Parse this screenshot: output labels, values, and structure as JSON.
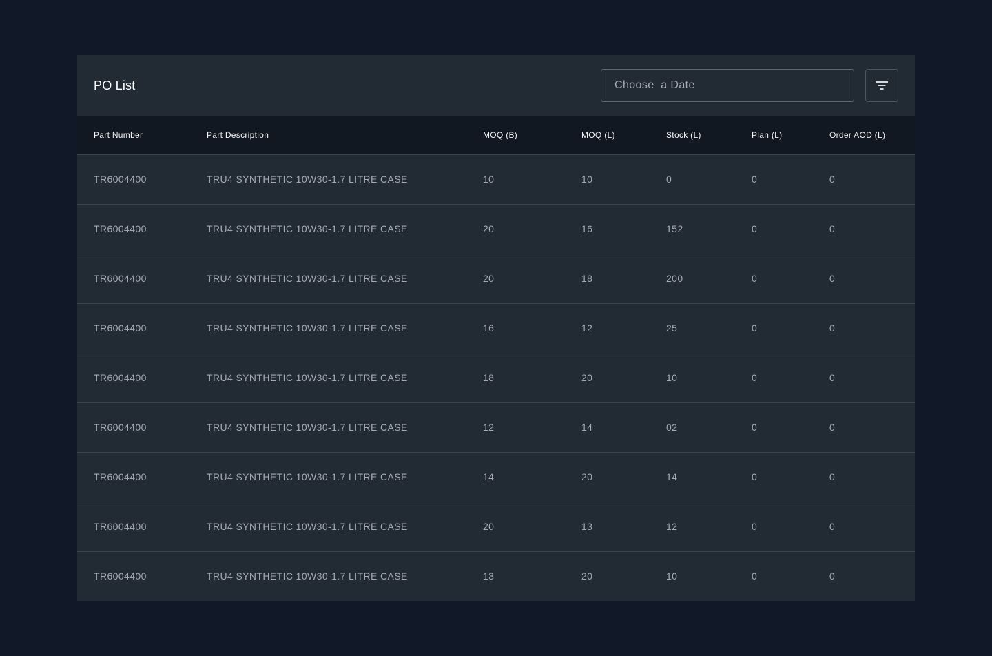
{
  "header": {
    "title": "PO List",
    "date_placeholder": "Choose  a Date",
    "filter_icon": "filter-icon"
  },
  "table": {
    "columns": [
      "Part Number",
      "Part Description",
      "MOQ (B)",
      "MOQ (L)",
      "Stock (L)",
      "Plan (L)",
      "Order AOD (L)"
    ],
    "rows": [
      [
        "TR6004400",
        "TRU4 SYNTHETIC 10W30-1.7 LITRE CASE",
        "10",
        "10",
        "0",
        "0",
        "0"
      ],
      [
        "TR6004400",
        "TRU4 SYNTHETIC 10W30-1.7 LITRE CASE",
        "20",
        "16",
        "152",
        "0",
        "0"
      ],
      [
        "TR6004400",
        "TRU4 SYNTHETIC 10W30-1.7 LITRE CASE",
        "20",
        "18",
        "200",
        "0",
        "0"
      ],
      [
        "TR6004400",
        "TRU4 SYNTHETIC 10W30-1.7 LITRE CASE",
        "16",
        "12",
        "25",
        "0",
        "0"
      ],
      [
        "TR6004400",
        "TRU4 SYNTHETIC 10W30-1.7 LITRE CASE",
        "18",
        "20",
        "10",
        "0",
        "0"
      ],
      [
        "TR6004400",
        "TRU4 SYNTHETIC 10W30-1.7 LITRE CASE",
        "12",
        "14",
        "02",
        "0",
        "0"
      ],
      [
        "TR6004400",
        "TRU4 SYNTHETIC 10W30-1.7 LITRE CASE",
        "14",
        "20",
        "14",
        "0",
        "0"
      ],
      [
        "TR6004400",
        "TRU4 SYNTHETIC 10W30-1.7 LITRE CASE",
        "20",
        "13",
        "12",
        "0",
        "0"
      ],
      [
        "TR6004400",
        "TRU4 SYNTHETIC 10W30-1.7 LITRE CASE",
        "13",
        "20",
        "10",
        "0",
        "0"
      ]
    ]
  },
  "colors": {
    "page_bg": "#111827",
    "card_bg": "#222A34",
    "header_row_bg": "#121821",
    "row_divider": "#3A424D"
  }
}
